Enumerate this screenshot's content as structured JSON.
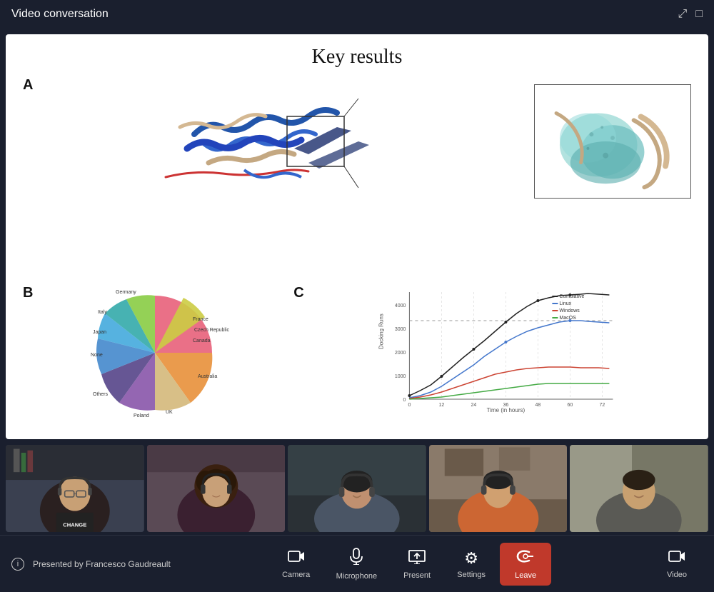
{
  "titleBar": {
    "title": "Video conversation",
    "expandIcon": "⤢",
    "windowIcon": "□"
  },
  "slide": {
    "title": "Key results",
    "figureA": {
      "label": "A",
      "description": "Protein structure visualization with zoomed inset"
    },
    "figureB": {
      "label": "B",
      "description": "Pie chart showing geographic distribution"
    },
    "figureC": {
      "label": "C",
      "description": "Line chart showing docking runs over time"
    }
  },
  "participants": [
    {
      "id": 1,
      "bgColor": "#3a4050"
    },
    {
      "id": 2,
      "bgColor": "#4a3545"
    },
    {
      "id": 3,
      "bgColor": "#354045"
    },
    {
      "id": 4,
      "bgColor": "#3d3840"
    },
    {
      "id": 5,
      "bgColor": "#404040"
    }
  ],
  "presenter": {
    "infoText": "Presented by Francesco Gaudreault"
  },
  "controls": [
    {
      "id": "camera",
      "label": "Camera",
      "icon": "□▶"
    },
    {
      "id": "microphone",
      "label": "Microphone",
      "icon": "🎤"
    },
    {
      "id": "present",
      "label": "Present",
      "icon": "↑□"
    },
    {
      "id": "settings",
      "label": "Settings",
      "icon": "⚙"
    },
    {
      "id": "leave",
      "label": "Leave",
      "icon": "☎"
    },
    {
      "id": "video",
      "label": "Video",
      "icon": "□▶"
    }
  ]
}
